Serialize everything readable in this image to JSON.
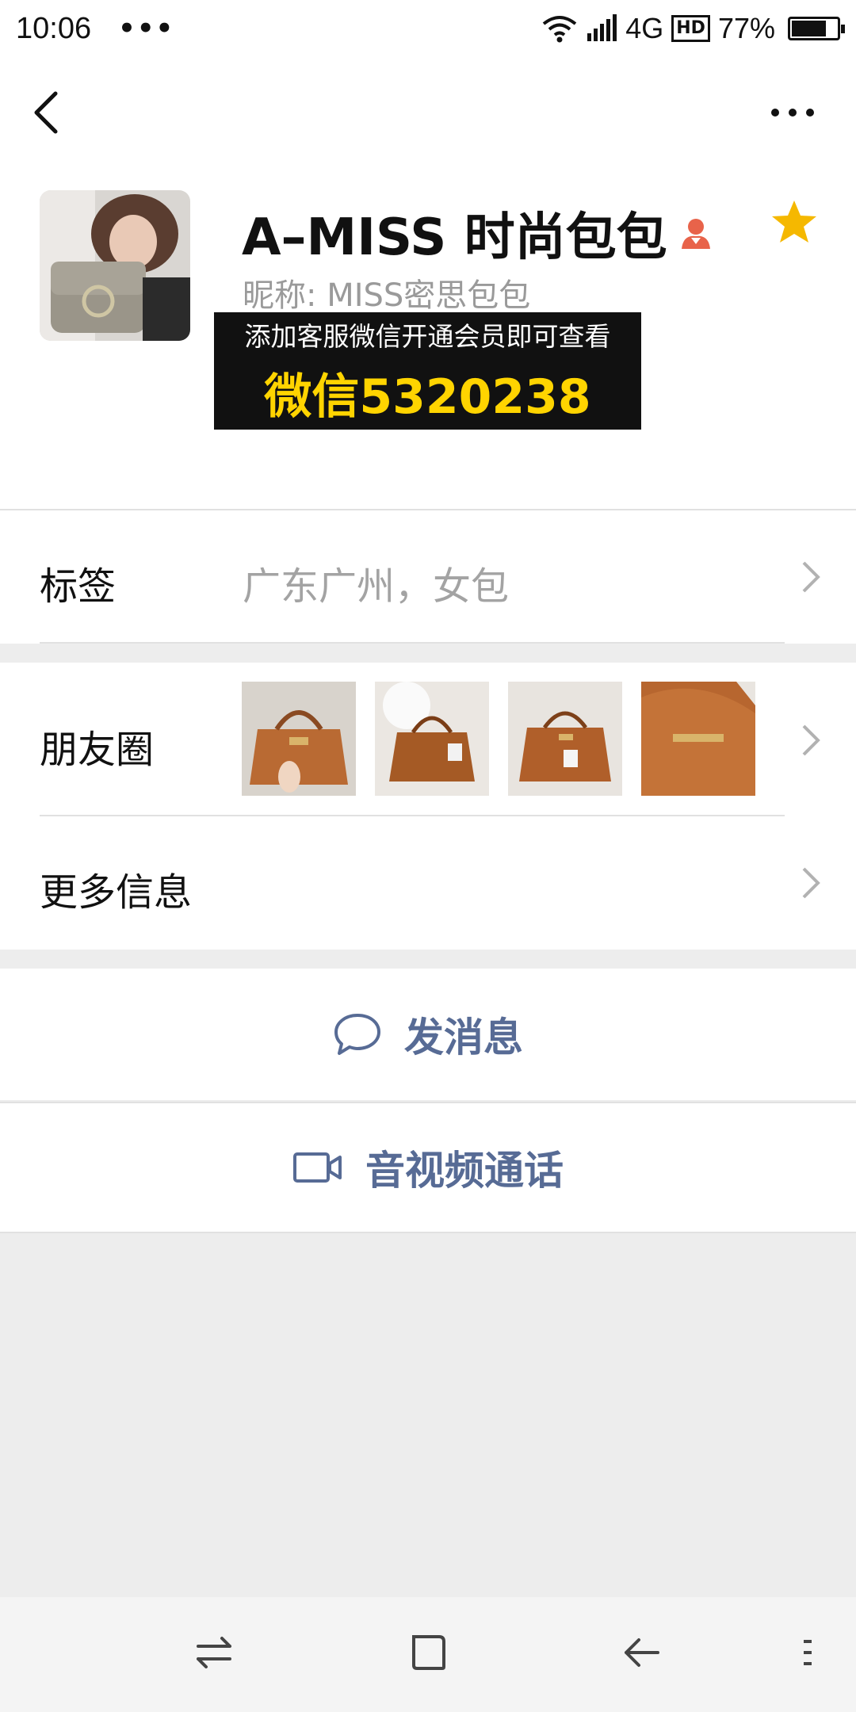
{
  "status_bar": {
    "time": "10:06",
    "dots": "•••",
    "network": "4G",
    "hd": "HD",
    "battery": "77%",
    "battery_level": 0.77
  },
  "nav": {
    "back_icon": "chevron-left-icon",
    "more_icon": "more-dots-icon"
  },
  "profile": {
    "name": "A–MISS 时尚包包",
    "nickname": "昵称: MISS密思包包",
    "promo_line1": "添加客服微信开通会员即可查看",
    "promo_line2": "微信5320238",
    "starred": true,
    "star_color": "#f5b800"
  },
  "tags_row": {
    "label": "标签",
    "value": "广东广州，女包"
  },
  "moments_row": {
    "label": "朋友圈",
    "thumbnails": [
      "bag-photo-1",
      "bag-photo-2",
      "bag-photo-3",
      "bag-photo-4"
    ]
  },
  "more_info_row": {
    "label": "更多信息"
  },
  "actions": {
    "message_label": "发消息",
    "call_label": "音视频通话",
    "link_color": "#576b95"
  }
}
